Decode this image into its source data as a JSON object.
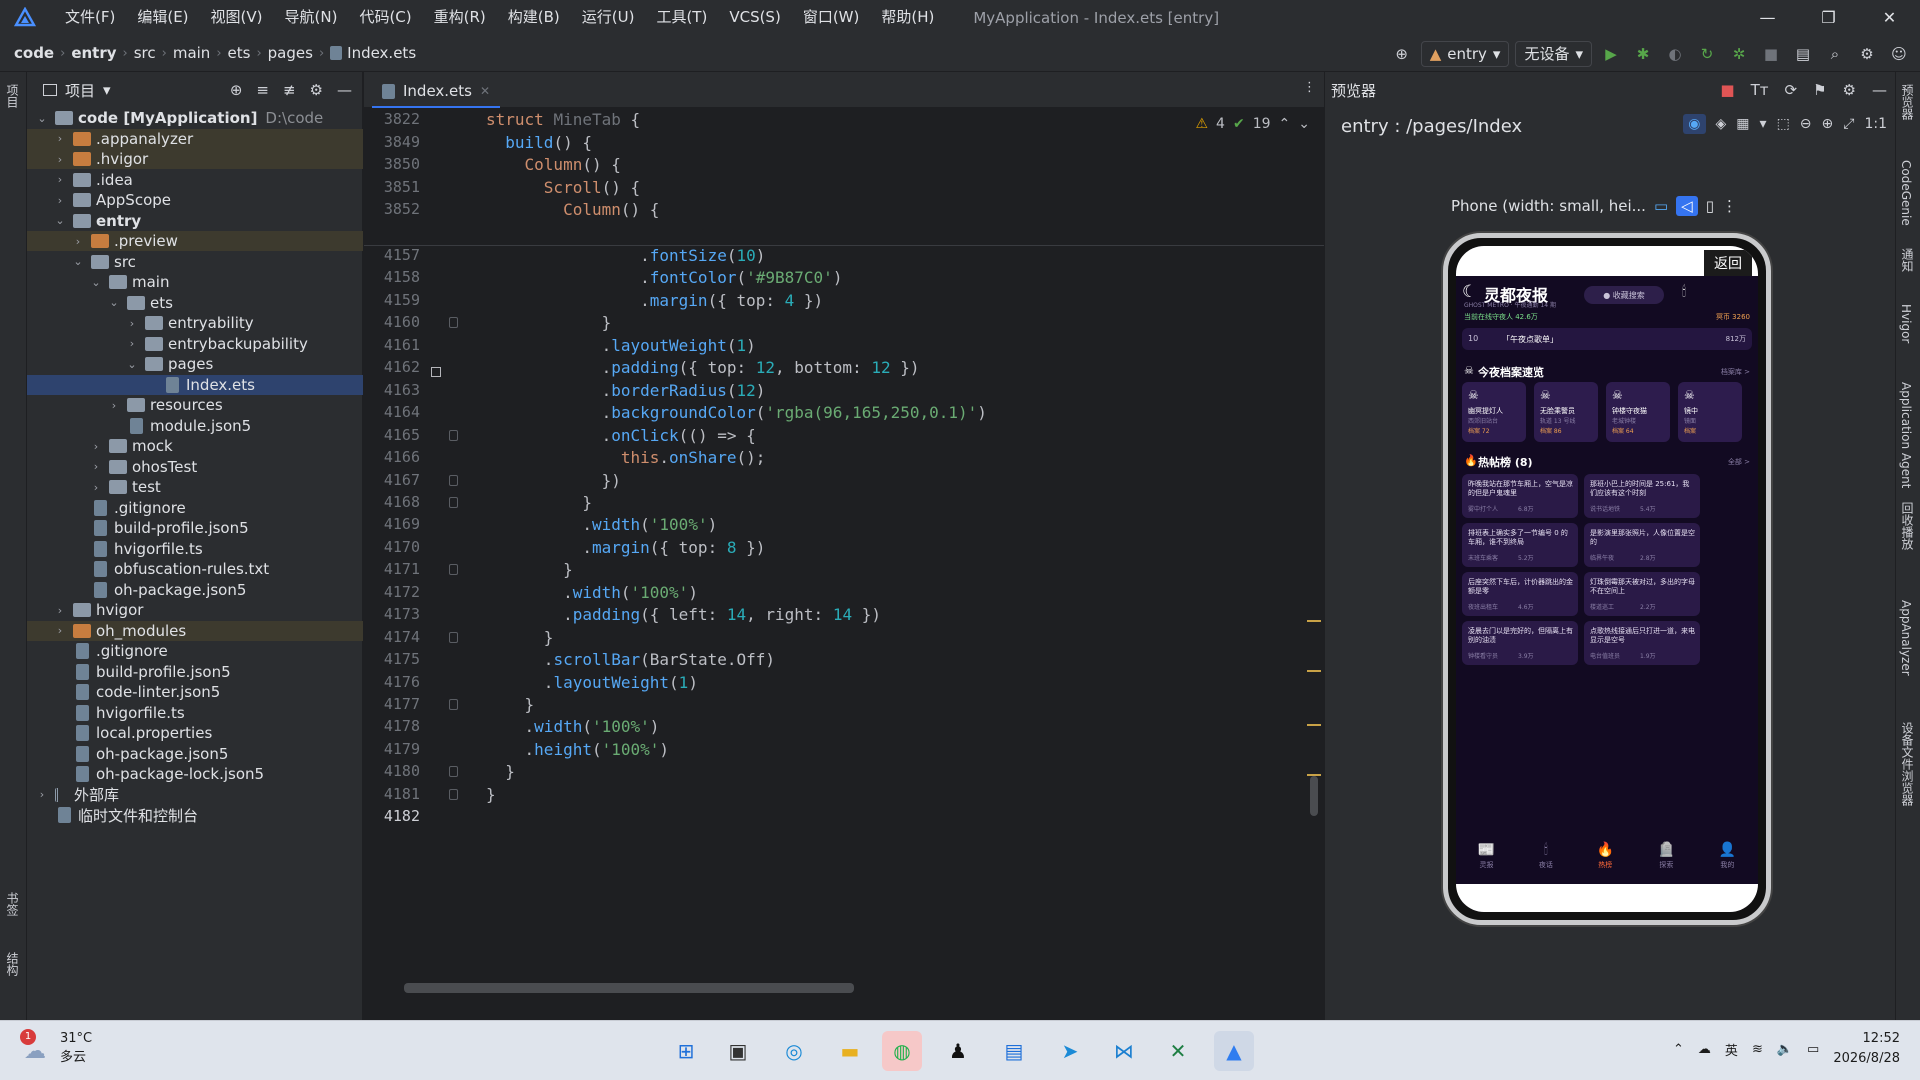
{
  "window": {
    "menu": [
      "文件(F)",
      "编辑(E)",
      "视图(V)",
      "导航(N)",
      "代码(C)",
      "重构(R)",
      "构建(B)",
      "运行(U)",
      "工具(T)",
      "VCS(S)",
      "窗口(W)",
      "帮助(H)"
    ],
    "title": "MyApplication - Index.ets [entry]"
  },
  "breadcrumb": {
    "root": "code",
    "items": [
      "entry",
      "src",
      "main",
      "ets",
      "pages"
    ],
    "file": "Index.ets"
  },
  "toolbar": {
    "config": "entry",
    "device": "无设备"
  },
  "left_strip": {
    "top": "项目",
    "bottom1": "书签",
    "bottom2": "结构"
  },
  "project": {
    "title": "项目",
    "rows": [
      {
        "indent": 0,
        "arrow": "⌄",
        "icon": "folder",
        "label": "code [MyApplication]",
        "extra": "D:\\code",
        "bold": true
      },
      {
        "indent": 1,
        "arrow": "›",
        "icon": "folder-o",
        "label": ".appanalyzer",
        "hl": true
      },
      {
        "indent": 1,
        "arrow": "›",
        "icon": "folder-o",
        "label": ".hvigor",
        "hl": true
      },
      {
        "indent": 1,
        "arrow": "›",
        "icon": "folder",
        "label": ".idea"
      },
      {
        "indent": 1,
        "arrow": "›",
        "icon": "folder",
        "label": "AppScope"
      },
      {
        "indent": 1,
        "arrow": "⌄",
        "icon": "folder",
        "label": "entry",
        "bold": true
      },
      {
        "indent": 2,
        "arrow": "›",
        "icon": "folder-o",
        "label": ".preview",
        "hl": true
      },
      {
        "indent": 2,
        "arrow": "⌄",
        "icon": "folder",
        "label": "src"
      },
      {
        "indent": 3,
        "arrow": "⌄",
        "icon": "folder",
        "label": "main"
      },
      {
        "indent": 4,
        "arrow": "⌄",
        "icon": "folder",
        "label": "ets"
      },
      {
        "indent": 5,
        "arrow": "›",
        "icon": "folder",
        "label": "entryability"
      },
      {
        "indent": 5,
        "arrow": "›",
        "icon": "folder",
        "label": "entrybackupability"
      },
      {
        "indent": 5,
        "arrow": "⌄",
        "icon": "folder",
        "label": "pages"
      },
      {
        "indent": 6,
        "arrow": "",
        "icon": "file",
        "label": "Index.ets",
        "sel": true
      },
      {
        "indent": 4,
        "arrow": "›",
        "icon": "folder",
        "label": "resources"
      },
      {
        "indent": 4,
        "arrow": "",
        "icon": "file",
        "label": "module.json5"
      },
      {
        "indent": 3,
        "arrow": "›",
        "icon": "folder",
        "label": "mock"
      },
      {
        "indent": 3,
        "arrow": "›",
        "icon": "folder",
        "label": "ohosTest"
      },
      {
        "indent": 3,
        "arrow": "›",
        "icon": "folder",
        "label": "test"
      },
      {
        "indent": 2,
        "arrow": "",
        "icon": "file",
        "label": ".gitignore"
      },
      {
        "indent": 2,
        "arrow": "",
        "icon": "file",
        "label": "build-profile.json5"
      },
      {
        "indent": 2,
        "arrow": "",
        "icon": "file",
        "label": "hvigorfile.ts"
      },
      {
        "indent": 2,
        "arrow": "",
        "icon": "file",
        "label": "obfuscation-rules.txt"
      },
      {
        "indent": 2,
        "arrow": "",
        "icon": "file",
        "label": "oh-package.json5"
      },
      {
        "indent": 1,
        "arrow": "›",
        "icon": "folder",
        "label": "hvigor"
      },
      {
        "indent": 1,
        "arrow": "›",
        "icon": "folder-o",
        "label": "oh_modules",
        "hl": true
      },
      {
        "indent": 1,
        "arrow": "",
        "icon": "file",
        "label": ".gitignore"
      },
      {
        "indent": 1,
        "arrow": "",
        "icon": "file",
        "label": "build-profile.json5"
      },
      {
        "indent": 1,
        "arrow": "",
        "icon": "file",
        "label": "code-linter.json5"
      },
      {
        "indent": 1,
        "arrow": "",
        "icon": "file",
        "label": "hvigorfile.ts"
      },
      {
        "indent": 1,
        "arrow": "",
        "icon": "file",
        "label": "local.properties"
      },
      {
        "indent": 1,
        "arrow": "",
        "icon": "file",
        "label": "oh-package.json5"
      },
      {
        "indent": 1,
        "arrow": "",
        "icon": "file",
        "label": "oh-package-lock.json5"
      },
      {
        "indent": 0,
        "arrow": "›",
        "icon": "lib",
        "label": "外部库"
      },
      {
        "indent": 0,
        "arrow": "",
        "icon": "scratch",
        "label": "临时文件和控制台"
      }
    ]
  },
  "editor": {
    "tab": "Index.ets",
    "inspections": {
      "warnings": "4",
      "ok": "19"
    },
    "sticky": [
      {
        "ln": "3822",
        "html": "<span class='kw'>struct</span> <span class='dimc'>MineTab</span> {"
      },
      {
        "ln": "3849",
        "html": "  <span class='fn'>build</span>() {"
      },
      {
        "ln": "3850",
        "html": "    <span class='kw'>Column</span>() {"
      },
      {
        "ln": "3851",
        "html": "      <span class='kw'>Scroll</span>() {"
      },
      {
        "ln": "3852",
        "html": "        <span class='kw'>Column</span>() {"
      }
    ],
    "lines": [
      {
        "ln": "4157",
        "html": "                .<span class='fn'>fontSize</span>(<span class='num'>10</span>)"
      },
      {
        "ln": "4158",
        "html": "                .<span class='fn'>fontColor</span>(<span class='str'>'#9B87C0'</span>)"
      },
      {
        "ln": "4159",
        "html": "                .<span class='fn'>margin</span>({ top: <span class='num'>4</span> })"
      },
      {
        "ln": "4160",
        "html": "            }"
      },
      {
        "ln": "4161",
        "html": "            .<span class='fn'>layoutWeight</span>(<span class='num'>1</span>)"
      },
      {
        "ln": "4162",
        "html": "            .<span class='fn'>padding</span>({ top: <span class='num'>12</span>, bottom: <span class='num'>12</span> })"
      },
      {
        "ln": "4163",
        "html": "            .<span class='fn'>borderRadius</span>(<span class='num'>12</span>)"
      },
      {
        "ln": "4164",
        "html": "            .<span class='fn'>backgroundColor</span>(<span class='str'>'rgba(96,165,250,0.1)'</span>)"
      },
      {
        "ln": "4165",
        "html": "            .<span class='fn'>onClick</span>(() => {"
      },
      {
        "ln": "4166",
        "html": "              <span class='kw'>this</span>.<span class='fn'>onShare</span>();"
      },
      {
        "ln": "4167",
        "html": "            })"
      },
      {
        "ln": "4168",
        "html": "          }"
      },
      {
        "ln": "4169",
        "html": "          .<span class='fn'>width</span>(<span class='str'>'100%'</span>)"
      },
      {
        "ln": "4170",
        "html": "          .<span class='fn'>margin</span>({ top: <span class='num'>8</span> })"
      },
      {
        "ln": "4171",
        "html": "        }"
      },
      {
        "ln": "4172",
        "html": "        .<span class='fn'>width</span>(<span class='str'>'100%'</span>)"
      },
      {
        "ln": "4173",
        "html": "        .<span class='fn'>padding</span>({ left: <span class='num'>14</span>, right: <span class='num'>14</span> })"
      },
      {
        "ln": "4174",
        "html": "      }"
      },
      {
        "ln": "4175",
        "html": "      .<span class='fn'>scrollBar</span>(BarState.Off)"
      },
      {
        "ln": "4176",
        "html": "      .<span class='fn'>layoutWeight</span>(<span class='num'>1</span>)"
      },
      {
        "ln": "4177",
        "html": "    }"
      },
      {
        "ln": "4178",
        "html": "    .<span class='fn'>width</span>(<span class='str'>'100%'</span>)"
      },
      {
        "ln": "4179",
        "html": "    .<span class='fn'>height</span>(<span class='str'>'100%'</span>)"
      },
      {
        "ln": "4180",
        "html": "  }"
      },
      {
        "ln": "4181",
        "html": "}"
      },
      {
        "ln": "4182",
        "html": ""
      }
    ]
  },
  "preview": {
    "title": "预览器",
    "route": "entry : /pages/Index",
    "device": "Phone (width: small, hei...",
    "back": "返回",
    "app": {
      "title": "灵都夜报",
      "subtitle": "GHOST METRO · 午夜通勤 14 期",
      "search": "● 收藏搜索",
      "online": "当前在线守夜人 42.6万",
      "coins": "冥币 3260",
      "rank_num": "10",
      "rank_text": "「午夜点歌单」",
      "rank_val": "812万",
      "archive_title": "今夜档案速览",
      "archive_more": "档案库 >",
      "archives": [
        {
          "name": "幽冥提灯人",
          "desc": "西郊旧站台",
          "val": "档案 72"
        },
        {
          "name": "无脸乘警员",
          "desc": "轨道 13 号线",
          "val": "档案 86"
        },
        {
          "name": "钟楼守夜猫",
          "desc": "老城钟楼",
          "val": "档案 64"
        },
        {
          "name": "镜中",
          "desc": "镜面",
          "val": "档案"
        }
      ],
      "hot_title": "热帖榜 (8)",
      "hot_more": "全部 >",
      "posts": [
        {
          "t": "昨晚我站在那节车厢上，空气是凉的但是户鬼魂里",
          "a": "雾中打个人",
          "v": "6.8万"
        },
        {
          "t": "那班小巴上的时间是 25:61，我们应该有这个时刻",
          "a": "说书话地铁",
          "v": "5.4万"
        },
        {
          "t": "排班表上确实多了一节编号 0 的车厢，谁不到终局",
          "a": "末班车乘客",
          "v": "5.2万"
        },
        {
          "t": "是影演里那张照片，人像位置是空的",
          "a": "临界午夜",
          "v": "2.8万"
        },
        {
          "t": "后座突然下车后，计价器跳出的金额是零",
          "a": "夜班出租车",
          "v": "4.6万"
        },
        {
          "t": "灯珠倒霉那天被对过，多出的字母不在空间上",
          "a": "楼道巡工",
          "v": "2.2万"
        },
        {
          "t": "凌晨去门以是完好的，但隔离上有别的油渍",
          "a": "钟楼看守员",
          "v": "3.9万"
        },
        {
          "t": "点歌热线接通后只打进一道，来电显示是空号",
          "a": "电台值班员",
          "v": "1.9万"
        }
      ],
      "tabs": [
        "灵报",
        "夜话",
        "热榜",
        "探索",
        "我的"
      ]
    }
  },
  "right_strip": [
    "预览器",
    "CodeGenie",
    "通知",
    "Hvigor",
    "Application Agent",
    "回收播放",
    "AppAnalyzer",
    "设备文件浏览器"
  ],
  "taskbar": {
    "temp": "31°C",
    "weather": "多云",
    "badge": "1",
    "ime": "英",
    "time": "12:52",
    "date": "2026/8/28"
  }
}
